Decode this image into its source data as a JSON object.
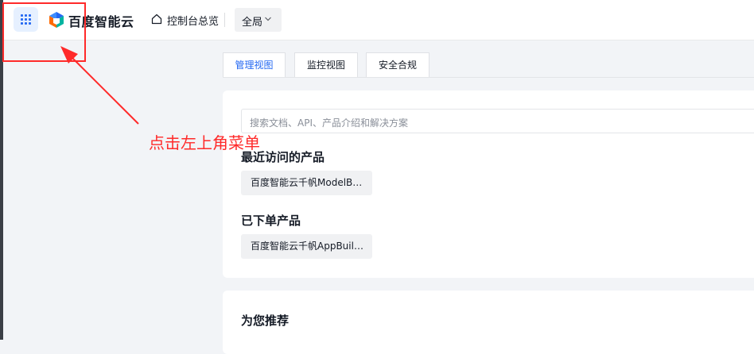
{
  "header": {
    "menu_icon": "grid-icon",
    "logo_text": "百度智能云",
    "home_icon": "home-icon",
    "home_link": "控制台总览",
    "region": "全局",
    "region_icon": "chevron-down-icon"
  },
  "tabs": [
    {
      "label": "管理视图",
      "active": true
    },
    {
      "label": "监控视图",
      "active": false
    },
    {
      "label": "安全合规",
      "active": false
    }
  ],
  "search": {
    "placeholder": "搜索文档、API、产品介绍和解决方案"
  },
  "recent": {
    "title": "最近访问的产品",
    "items": [
      "百度智能云千帆ModelB…"
    ]
  },
  "ordered": {
    "title": "已下单产品",
    "items": [
      "百度智能云千帆AppBuil…"
    ]
  },
  "recommend": {
    "title": "为您推荐"
  },
  "annotation": {
    "text": "点击左上角菜单",
    "color": "#ff2a2a"
  },
  "colors": {
    "accent": "#2468f2",
    "menu_bg": "#e6f0ff",
    "page_bg": "#f2f4f7"
  }
}
